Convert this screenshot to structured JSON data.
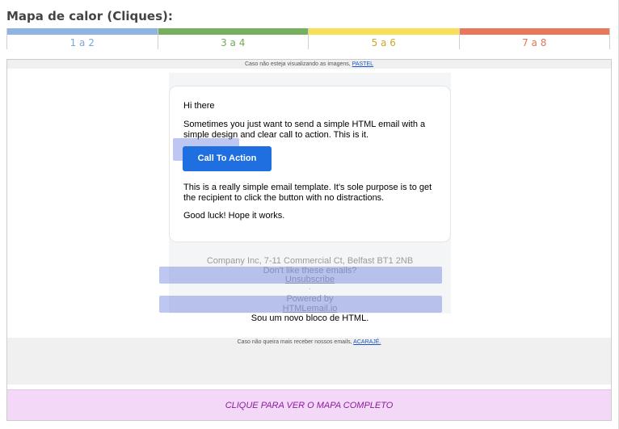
{
  "heatmap": {
    "title": "Mapa de calor (Cliques):",
    "legend": [
      {
        "label": "1 a 2",
        "color": "#8db4e2",
        "text_color": "#7aa7d8"
      },
      {
        "label": "3 a 4",
        "color": "#76b05f",
        "text_color": "#76a85c"
      },
      {
        "label": "5 a 6",
        "color": "#f7df5a",
        "text_color": "#c9a92a"
      },
      {
        "label": "7 a 8",
        "color": "#e9775a",
        "text_color": "#e07858"
      }
    ]
  },
  "email": {
    "preheader_text": "Caso não esteja visualizando as imagens,",
    "preheader_link": "PASTEL",
    "greeting": "Hi there",
    "intro": "Sometimes you just want to send a simple HTML email with a simple design and clear call to action. This is it.",
    "cta_label": "Call To Action",
    "body": "This is a really simple email template. It's sole purpose is to get the recipient to click the button with no distractions.",
    "closing": "Good luck! Hope it works.",
    "footer_company": "Company Inc, 7-11 Commercial Ct, Belfast BT1 2NB",
    "footer_dislike": "Don't like these emails?",
    "footer_unsubscribe": "Unsubscribe",
    "footer_dot": ".",
    "footer_powered": "Powered by",
    "footer_powered_link": "HTMLemail.io",
    "new_block": "Sou um novo bloco de HTML.",
    "bottom_text": "Caso não queira mais receber nossos emails,",
    "bottom_link": "ACARAJÉ."
  },
  "view_full_map": "CLIQUE PARA VER O MAPA COMPLETO"
}
